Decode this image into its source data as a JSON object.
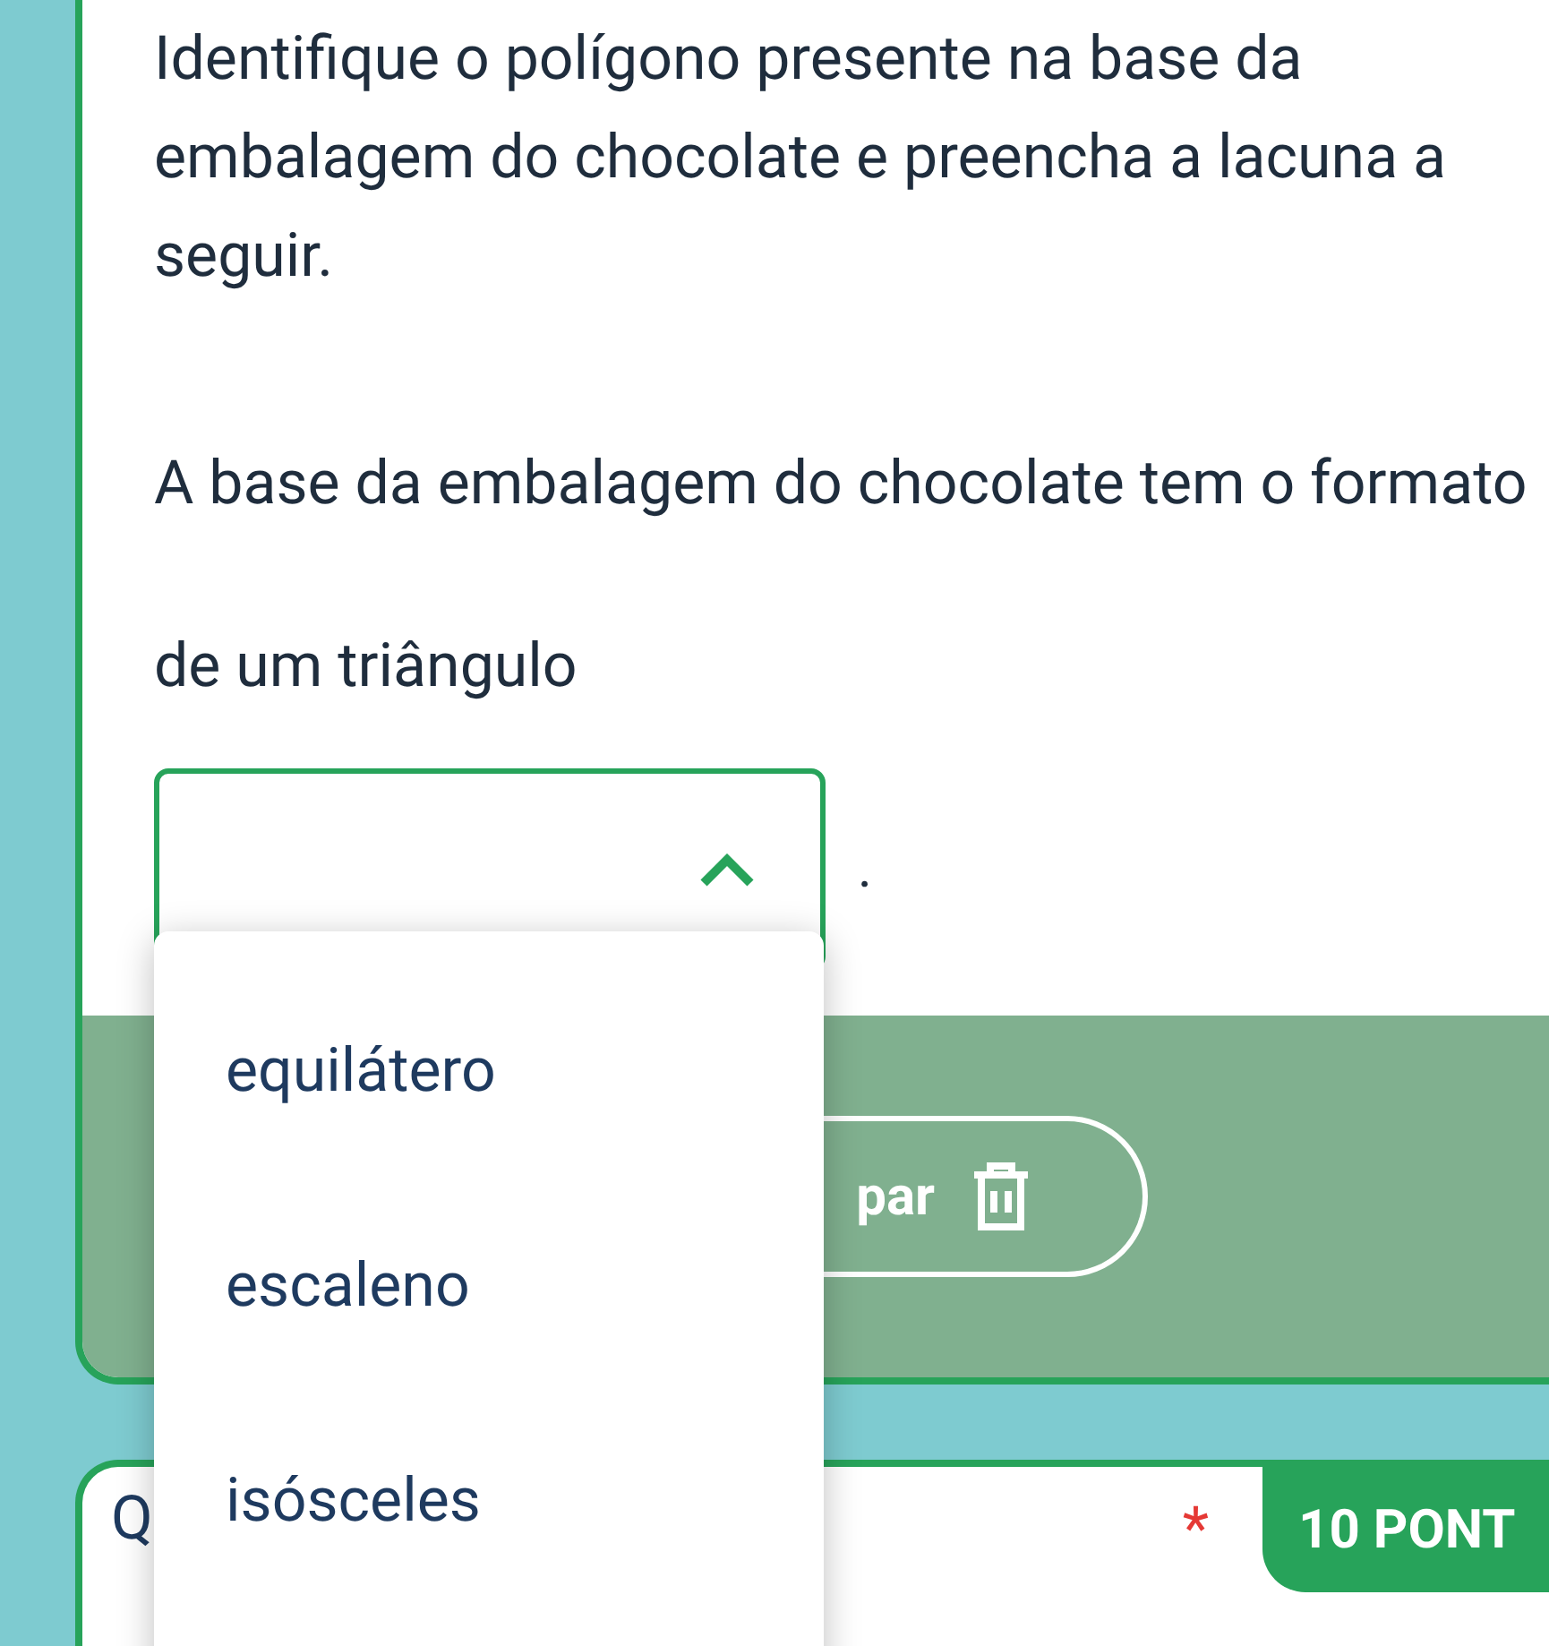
{
  "question": {
    "prompt": "Identifique o polígono presente na base da embalagem do chocolate e preencha a lacuna a seguir.",
    "sentence_before": "A base da embalagem do chocolate tem o formato de um triângulo",
    "sentence_after": ".",
    "select": {
      "expanded": true
    }
  },
  "footer": {
    "clear_button": "par"
  },
  "dropdown_options": [
    {
      "label": "equilátero",
      "selected": false
    },
    {
      "label": "escaleno",
      "selected": false
    },
    {
      "label": "isósceles",
      "selected": false
    }
  ],
  "next_question": {
    "title": "Q",
    "required_mark": "*",
    "points": "10 PONT"
  }
}
